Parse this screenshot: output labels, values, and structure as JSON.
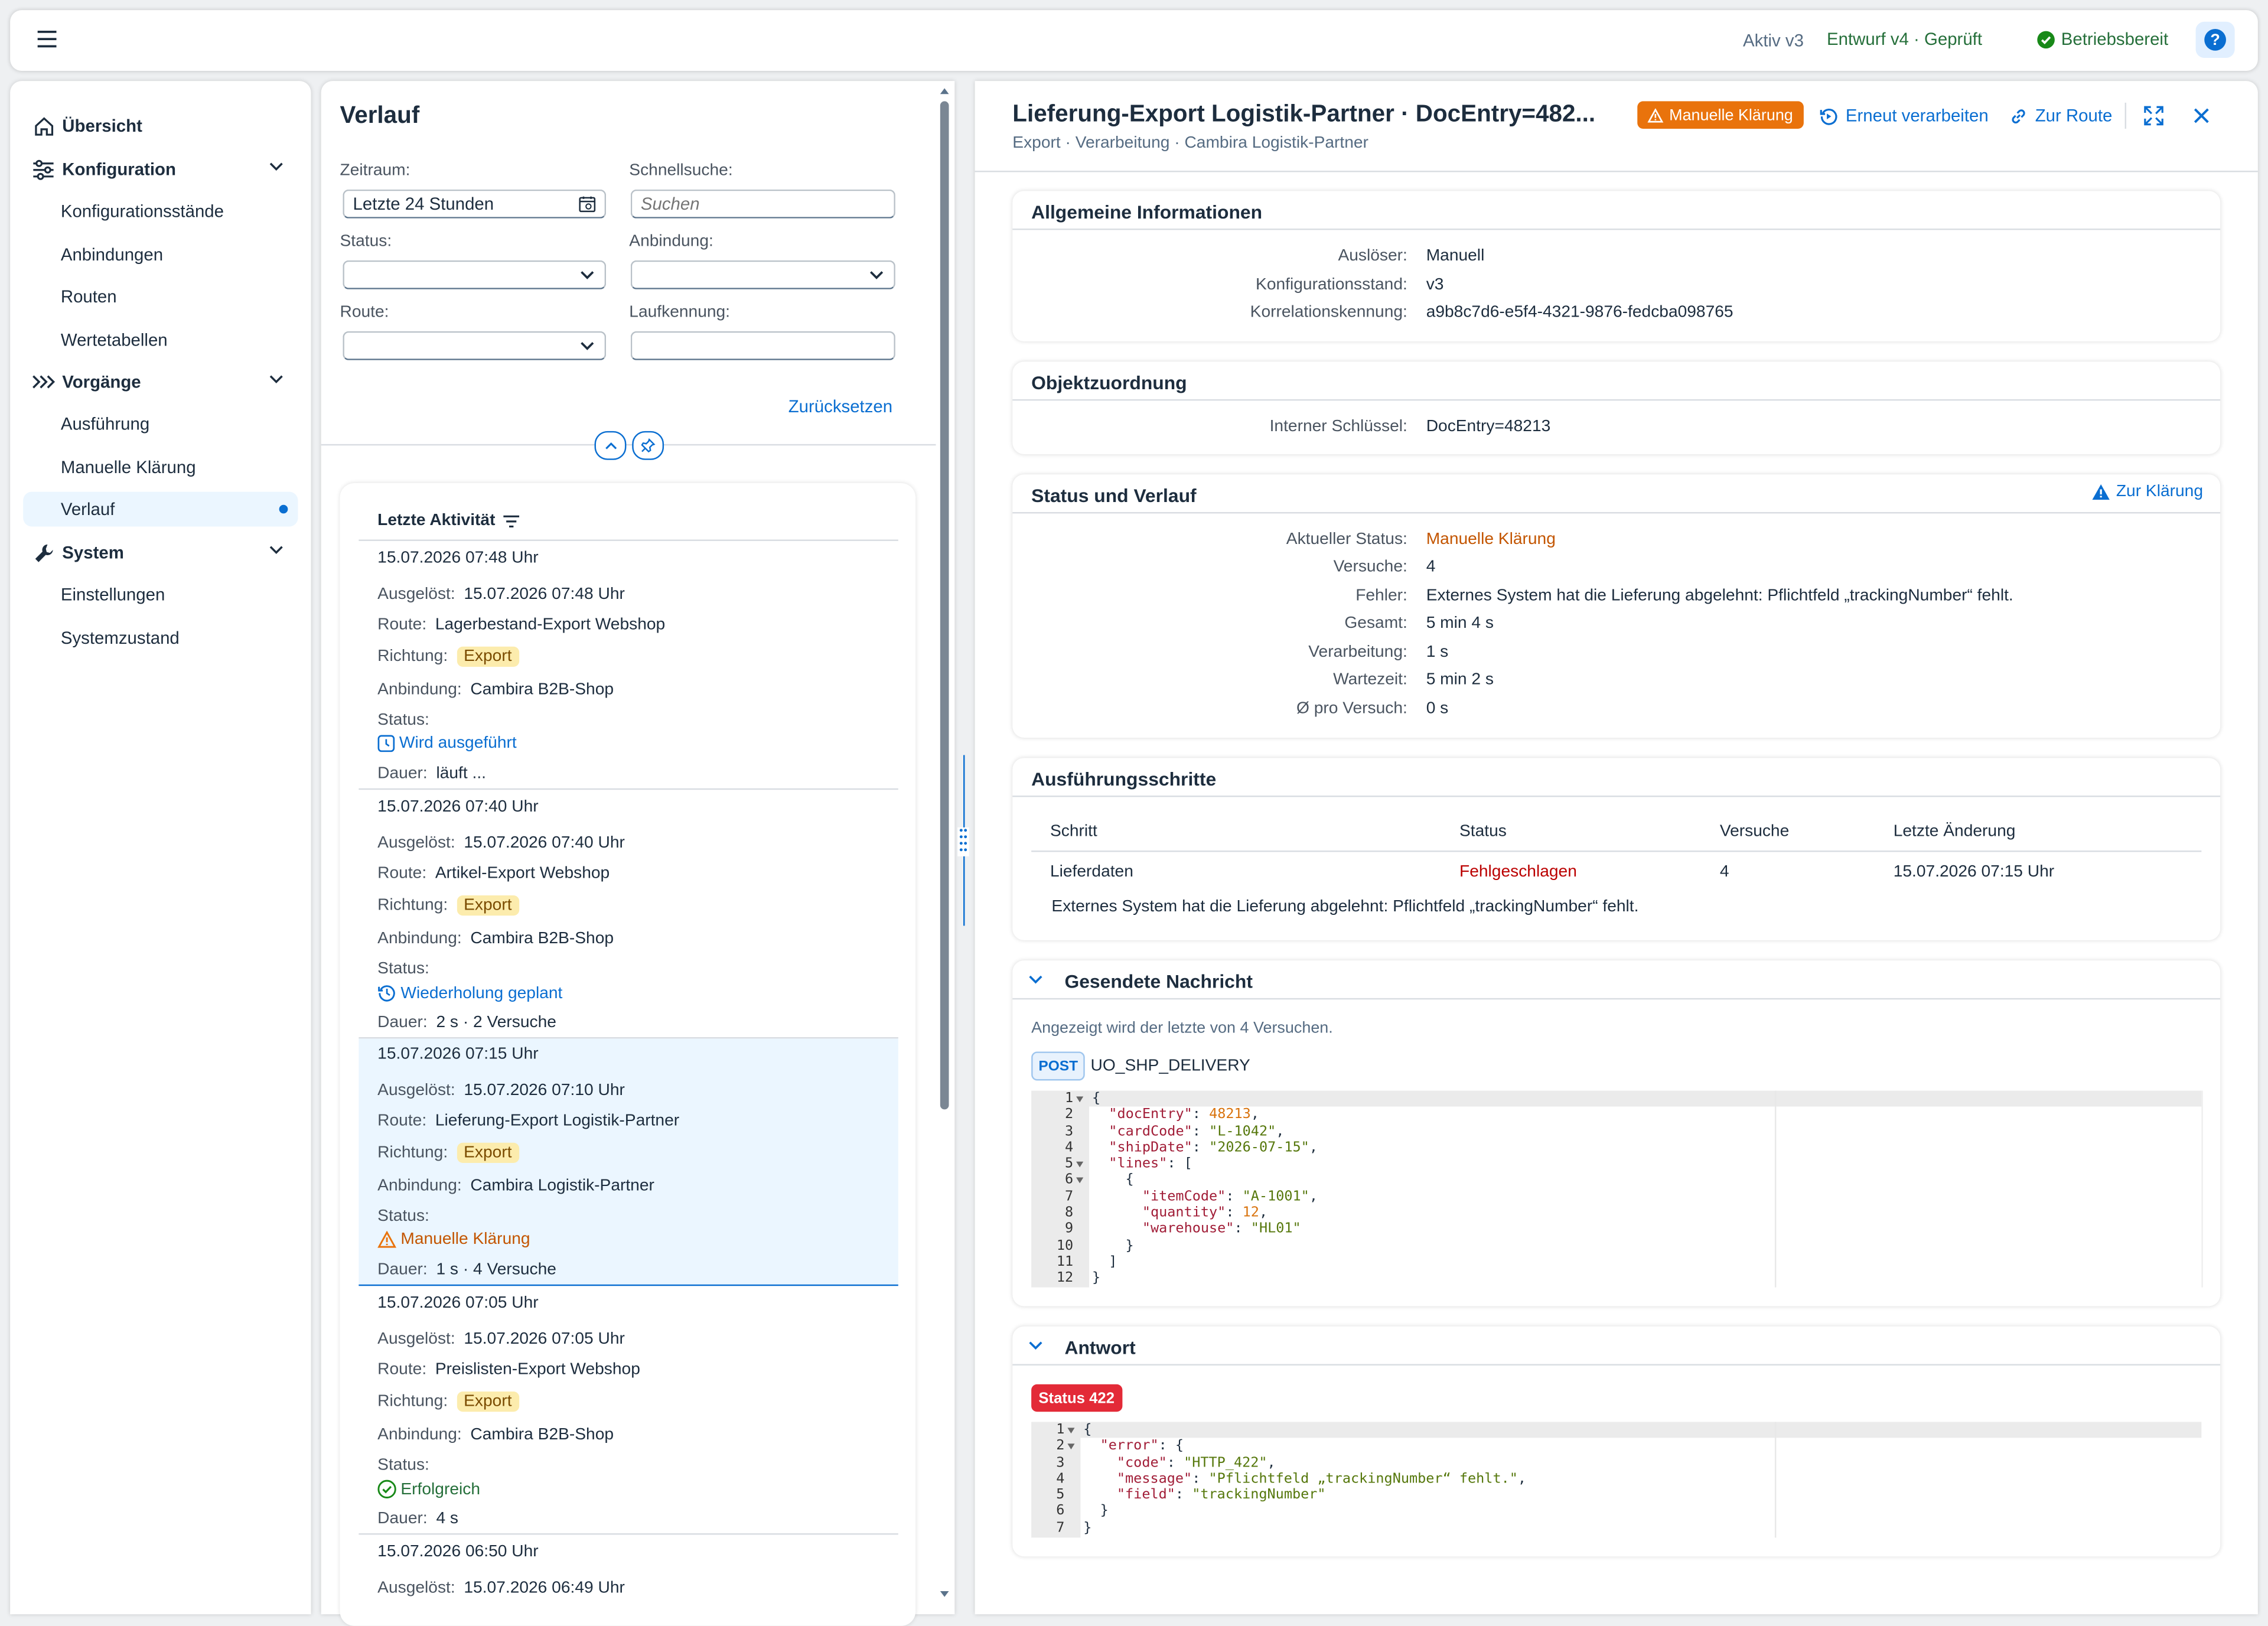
{
  "shell": {
    "active_version": "Aktiv v3",
    "draft_version": "Entwurf v4 · Geprüft",
    "readiness": "Betriebsbereit",
    "help_symbol": "?"
  },
  "nav": {
    "overview": "Übersicht",
    "configuration": "Konfiguration",
    "config_items": [
      "Konfigurationsstände",
      "Anbindungen",
      "Routen",
      "Wertetabellen"
    ],
    "processes": "Vorgänge",
    "process_items": [
      "Ausführung",
      "Manuelle Klärung",
      "Verlauf"
    ],
    "system": "System",
    "system_items": [
      "Einstellungen",
      "Systemzustand"
    ]
  },
  "history": {
    "title": "Verlauf",
    "filters": {
      "period_label": "Zeitraum:",
      "period_value": "Letzte 24 Stunden",
      "quicksearch_label": "Schnellsuche:",
      "quicksearch_placeholder": "Suchen",
      "status_label": "Status:",
      "connection_label": "Anbindung:",
      "route_label": "Route:",
      "run_id_label": "Laufkennung:",
      "reset": "Zurücksetzen"
    },
    "list_header": "Letzte Aktivität",
    "labels": {
      "triggered": "Ausgelöst:",
      "route": "Route:",
      "direction": "Richtung:",
      "connection": "Anbindung:",
      "status": "Status:",
      "duration": "Dauer:"
    },
    "items": [
      {
        "time": "15.07.2026 07:48 Uhr",
        "triggered": "15.07.2026 07:48 Uhr",
        "route": "Lagerbestand-Export Webshop",
        "direction": "Export",
        "connection": "Cambira B2B-Shop",
        "status": "Wird ausgeführt",
        "duration": "läuft ..."
      },
      {
        "time": "15.07.2026 07:40 Uhr",
        "triggered": "15.07.2026 07:40 Uhr",
        "route": "Artikel-Export Webshop",
        "direction": "Export",
        "connection": "Cambira B2B-Shop",
        "status": "Wiederholung geplant",
        "duration": "2 s · 2 Versuche"
      },
      {
        "time": "15.07.2026 07:15 Uhr",
        "triggered": "15.07.2026 07:10 Uhr",
        "route": "Lieferung-Export Logistik-Partner",
        "direction": "Export",
        "connection": "Cambira Logistik-Partner",
        "status": "Manuelle Klärung",
        "duration": "1 s · 4 Versuche"
      },
      {
        "time": "15.07.2026 07:05 Uhr",
        "triggered": "15.07.2026 07:05 Uhr",
        "route": "Preislisten-Export Webshop",
        "direction": "Export",
        "connection": "Cambira B2B-Shop",
        "status": "Erfolgreich",
        "duration": "4 s"
      },
      {
        "time": "15.07.2026 06:50 Uhr",
        "triggered": "15.07.2026 06:49 Uhr"
      }
    ]
  },
  "detail": {
    "title": "Lieferung-Export Logistik-Partner · DocEntry=482...",
    "subtitle": "Export · Verarbeitung · Cambira Logistik-Partner",
    "status_badge": "Manuelle Klärung",
    "reprocess": "Erneut verarbeiten",
    "to_route": "Zur Route",
    "general": {
      "title": "Allgemeine Informationen",
      "rows": [
        {
          "k": "Auslöser:",
          "v": "Manuell"
        },
        {
          "k": "Konfigurationsstand:",
          "v": "v3"
        },
        {
          "k": "Korrelationskennung:",
          "v": "a9b8c7d6-e5f4-4321-9876-fedcba098765"
        }
      ]
    },
    "object": {
      "title": "Objektzuordnung",
      "rows": [
        {
          "k": "Interner Schlüssel:",
          "v": "DocEntry=48213"
        }
      ]
    },
    "status": {
      "title": "Status und Verlauf",
      "to_clarification": "Zur Klärung",
      "rows": [
        {
          "k": "Aktueller Status:",
          "v": "Manuelle Klärung"
        },
        {
          "k": "Versuche:",
          "v": "4"
        },
        {
          "k": "Fehler:",
          "v": "Externes System hat die Lieferung abgelehnt: Pflichtfeld „trackingNumber“ fehlt."
        },
        {
          "k": "Gesamt:",
          "v": "5 min 4 s"
        },
        {
          "k": "Verarbeitung:",
          "v": "1 s"
        },
        {
          "k": "Wartezeit:",
          "v": "5 min 2 s"
        },
        {
          "k": "Ø pro Versuch:",
          "v": "0 s"
        }
      ]
    },
    "steps": {
      "title": "Ausführungsschritte",
      "columns": [
        "Schritt",
        "Status",
        "Versuche",
        "Letzte Änderung"
      ],
      "row": {
        "step": "Lieferdaten",
        "status": "Fehlgeschlagen",
        "attempts": "4",
        "changed": "15.07.2026 07:15 Uhr"
      },
      "error": "Externes System hat die Lieferung abgelehnt: Pflichtfeld „trackingNumber“ fehlt."
    },
    "sent": {
      "title": "Gesendete Nachricht",
      "note": "Angezeigt wird der letzte von 4 Versuchen.",
      "method": "POST",
      "endpoint": "UO_SHP_DELIVERY",
      "lines": [
        "{",
        "  \"docEntry\": 48213,",
        "  \"cardCode\": \"L-1042\",",
        "  \"shipDate\": \"2026-07-15\",",
        "  \"lines\": [",
        "    {",
        "      \"itemCode\": \"A-1001\",",
        "      \"quantity\": 12,",
        "      \"warehouse\": \"HL01\"",
        "    }",
        "  ]",
        "}"
      ]
    },
    "response": {
      "title": "Antwort",
      "status_badge": "Status 422",
      "lines": [
        "{",
        "  \"error\": {",
        "    \"code\": \"HTTP_422\",",
        "    \"message\": \"Pflichtfeld „trackingNumber“ fehlt.\",",
        "    \"field\": \"trackingNumber\"",
        "  }",
        "}"
      ]
    }
  },
  "colors": {
    "accent": "#0a6ed1",
    "warning": "#e9730c",
    "error": "#bb0000",
    "positive": "#188918"
  }
}
